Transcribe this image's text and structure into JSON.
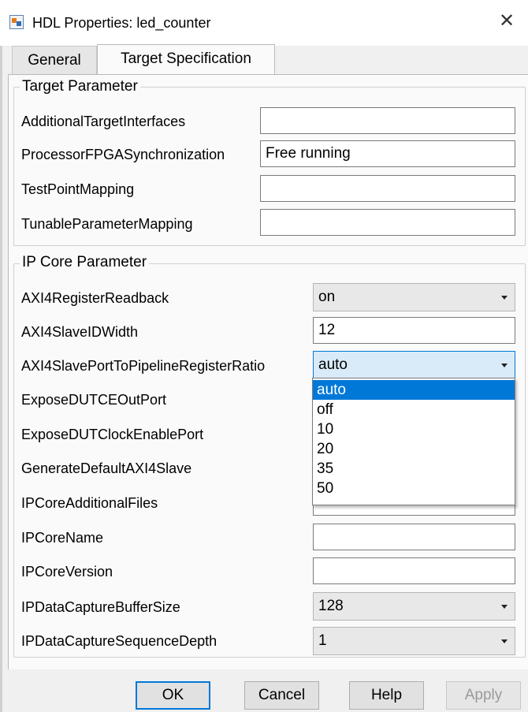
{
  "window": {
    "title": "HDL Properties: led_counter",
    "close_glyph": "✕",
    "icon": "simulink-block-icon"
  },
  "tabs": [
    {
      "label": "General",
      "active": false
    },
    {
      "label": "Target Specification",
      "active": true
    }
  ],
  "target_parameter": {
    "legend": "Target Parameter",
    "rows": [
      {
        "label": "AdditionalTargetInterfaces",
        "value": ""
      },
      {
        "label": "ProcessorFPGASynchronization",
        "value": "Free running"
      },
      {
        "label": "TestPointMapping",
        "value": ""
      },
      {
        "label": "TunableParameterMapping",
        "value": ""
      }
    ]
  },
  "ip_core_parameter": {
    "legend": "IP Core Parameter",
    "rows": [
      {
        "label": "AXI4RegisterReadback",
        "value": "on",
        "kind": "combo"
      },
      {
        "label": "AXI4SlaveIDWidth",
        "value": "12",
        "kind": "text"
      },
      {
        "label": "AXI4SlavePortToPipelineRegisterRatio",
        "value": "auto",
        "kind": "combo"
      },
      {
        "label": "ExposeDUTCEOutPort",
        "value": "",
        "kind": "hidden"
      },
      {
        "label": "ExposeDUTClockEnablePort",
        "value": "",
        "kind": "hidden"
      },
      {
        "label": "GenerateDefaultAXI4Slave",
        "value": "",
        "kind": "hidden"
      },
      {
        "label": "IPCoreAdditionalFiles",
        "value": "",
        "kind": "text"
      },
      {
        "label": "IPCoreName",
        "value": "",
        "kind": "text"
      },
      {
        "label": "IPCoreVersion",
        "value": "",
        "kind": "text"
      },
      {
        "label": "IPDataCaptureBufferSize",
        "value": "128",
        "kind": "combo"
      },
      {
        "label": "IPDataCaptureSequenceDepth",
        "value": "1",
        "kind": "combo"
      }
    ]
  },
  "dropdown": {
    "options": [
      "auto",
      "off",
      "10",
      "20",
      "35",
      "50"
    ],
    "selected": "auto"
  },
  "buttons": {
    "ok": "OK",
    "cancel": "Cancel",
    "help": "Help",
    "apply": "Apply"
  },
  "colors": {
    "accent": "#0078d7",
    "combo_bg": "#e8e8e8",
    "panel_bg": "#fafafa"
  }
}
